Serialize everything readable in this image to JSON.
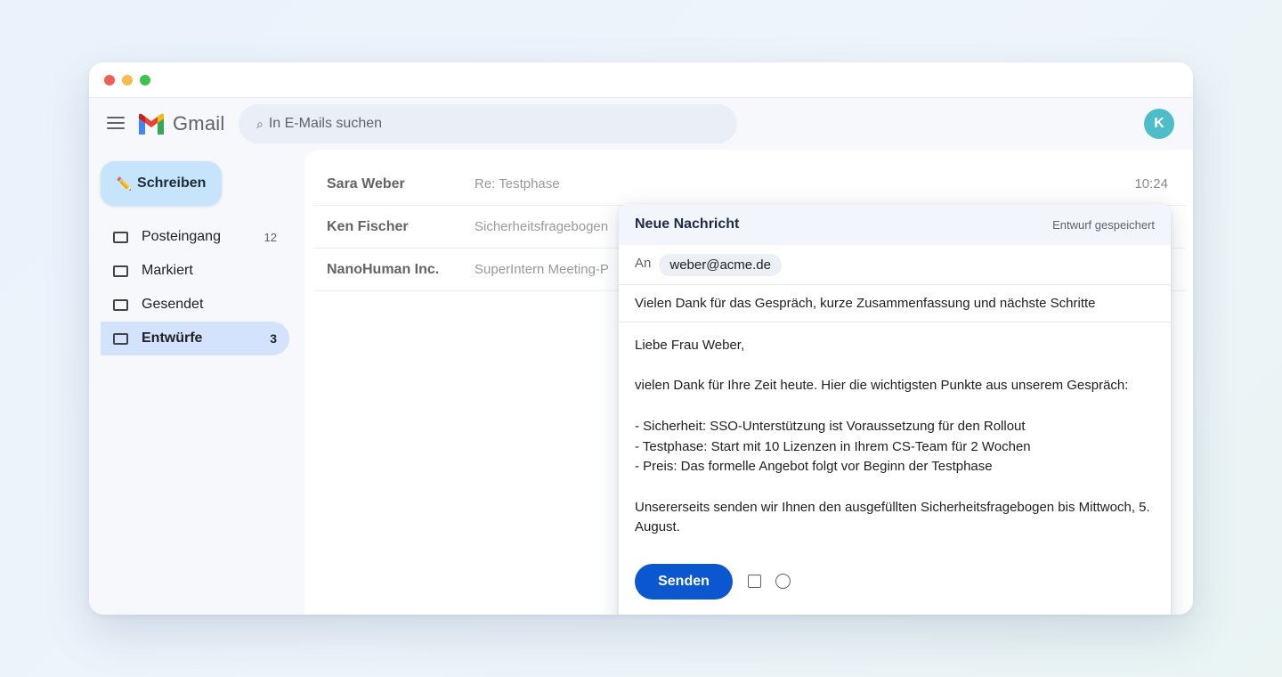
{
  "app": {
    "name": "Gmail",
    "avatar_initial": "K"
  },
  "search": {
    "placeholder": "In E-Mails suchen"
  },
  "compose_button": {
    "icon": "✏️",
    "label": "Schreiben"
  },
  "folders": [
    {
      "label": "Posteingang",
      "count": "12"
    },
    {
      "label": "Markiert",
      "count": ""
    },
    {
      "label": "Gesendet",
      "count": ""
    },
    {
      "label": "Entwürfe",
      "count": "3",
      "active": true
    }
  ],
  "mails": [
    {
      "sender": "Sara Weber",
      "subject": "Re: Testphase",
      "time": "10:24"
    },
    {
      "sender": "Ken Fischer",
      "subject": "Sicherheitsfragebogen",
      "time": ""
    },
    {
      "sender": "NanoHuman Inc.",
      "subject": "SuperIntern Meeting-P",
      "time": ""
    }
  ],
  "compose": {
    "title": "Neue Nachricht",
    "status": "Entwurf gespeichert",
    "to_label": "An",
    "to": "weber@acme.de",
    "subject": "Vielen Dank für das Gespräch, kurze Zusammenfassung und nächste Schritte",
    "body": "Liebe Frau Weber,\n\nvielen Dank für Ihre Zeit heute. Hier die wichtigsten Punkte aus unserem Gespräch:\n\n- Sicherheit: SSO-Unterstützung ist Voraussetzung für den Rollout\n- Testphase: Start mit 10 Lizenzen in Ihrem CS-Team für 2 Wochen\n- Preis: Das formelle Angebot folgt vor Beginn der Testphase\n\nUnsererseits senden wir Ihnen den ausgefüllten Sicherheitsfragebogen bis Mittwoch, 5. August.",
    "send_label": "Senden"
  },
  "colors": {
    "accent": "#0b57d0",
    "compose_button_bg": "#c6e4fb",
    "active_folder_bg": "#d3e3fd",
    "avatar_bg": "#4fbdc9"
  }
}
